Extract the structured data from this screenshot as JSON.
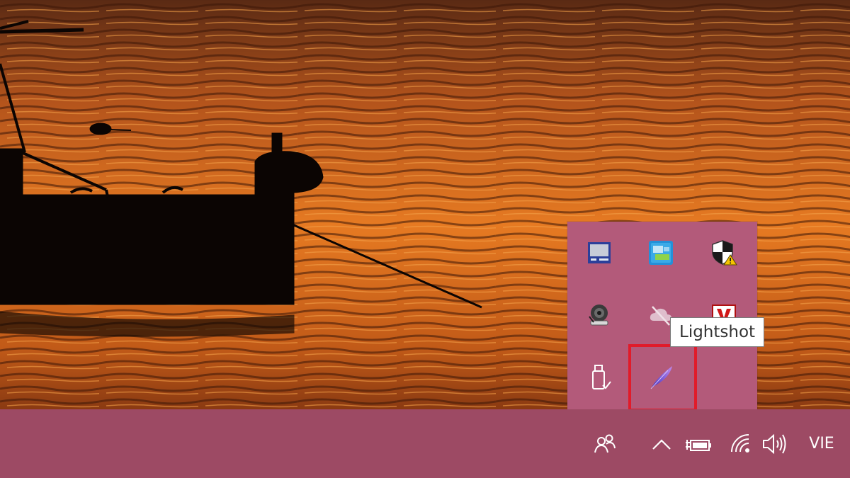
{
  "tray": {
    "flyout_icons": [
      {
        "id": "network-adapter",
        "icon": "computer-monitor-icon"
      },
      {
        "id": "intel-graphics",
        "icon": "intel-graphics-icon"
      },
      {
        "id": "windows-security",
        "icon": "shield-warning-icon"
      },
      {
        "id": "speaker",
        "icon": "speaker-icon"
      },
      {
        "id": "onedrive",
        "icon": "cloud-off-icon"
      },
      {
        "id": "antivirus",
        "icon": "red-v-icon"
      },
      {
        "id": "safely-remove",
        "icon": "usb-drive-check-icon"
      },
      {
        "id": "lightshot",
        "icon": "lightshot-feather-icon"
      }
    ],
    "tooltip": "Lightshot",
    "highlight_color": "#e11b2a"
  },
  "taskbar": {
    "background": "#9d4a64",
    "language": "VIE",
    "buttons": [
      "people-icon",
      "chevron-up-icon",
      "battery-charging-icon",
      "wifi-icon",
      "volume-icon"
    ]
  },
  "colors": {
    "flyout_bg": "#b35a7a",
    "tooltip_bg": "#ffffff"
  }
}
